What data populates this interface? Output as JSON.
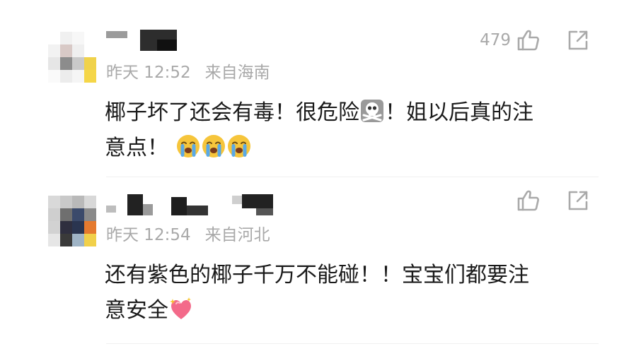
{
  "comments": [
    {
      "time": "昨天 12:52",
      "location": "来自海南",
      "likes": "479",
      "text_part1": "椰子坏了还会有毒！很危险",
      "text_part2": "！姐以后真的注",
      "text_part3": "意点！",
      "emojis": [
        "skull-crossbones",
        "loudly-crying-face",
        "loudly-crying-face",
        "loudly-crying-face"
      ]
    },
    {
      "time": "昨天 12:54",
      "location": "来自河北",
      "likes": "",
      "text_part1": "还有紫色的椰子千万不能碰！！宝宝们都要注",
      "text_part2": "意安全",
      "emojis": [
        "sparkling-heart"
      ]
    }
  ],
  "colors": {
    "text": "#1a1a1a",
    "meta": "#a9a9a9",
    "background": "#ffffff"
  }
}
